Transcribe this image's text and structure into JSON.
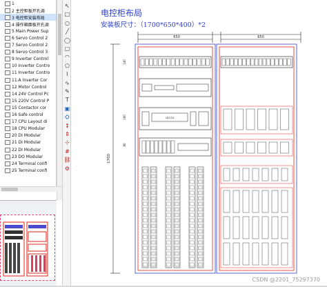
{
  "tree": {
    "items": [
      {
        "label": "1",
        "partial": true
      },
      {
        "label": "2 主控柜板开孔调"
      },
      {
        "label": "3 电控柜安装布局",
        "selected": true
      },
      {
        "label": "4 操作箱面板开孔调"
      },
      {
        "label": "5 Main Power Sup"
      },
      {
        "label": "6 Servo Control 2"
      },
      {
        "label": "7 Servo Control 2"
      },
      {
        "label": "8 Servo Control 3"
      },
      {
        "label": "9 Inverter Control"
      },
      {
        "label": "10 Inverter Contro"
      },
      {
        "label": "11 Inverter Contro"
      },
      {
        "label": "11.A Inverter Cor"
      },
      {
        "label": "12 Motor Control"
      },
      {
        "label": "14 24V Control Pc"
      },
      {
        "label": "15 220V Control P"
      },
      {
        "label": "15 Contactor cor"
      },
      {
        "label": "16 Safe control"
      },
      {
        "label": "17 CPU Layout di"
      },
      {
        "label": "18 CPU Modular"
      },
      {
        "label": "20 DI Modular"
      },
      {
        "label": "21 DI Modular"
      },
      {
        "label": "22 DI Modular"
      },
      {
        "label": "23 DO Modular"
      },
      {
        "label": "24 Terminal confi"
      },
      {
        "label": "25 Terminal confi"
      }
    ]
  },
  "toolbar": {
    "tools": [
      "pointer-tool-icon",
      "rectangle-tool-icon",
      "circle-tool-icon",
      "line-tool-icon",
      "ellipse-tool-icon",
      "rounded-rect-tool-icon",
      "arc-tool-icon",
      "polygon-tool-icon",
      "polyline-tool-icon",
      "spline-tool-icon",
      "freehand-tool-icon",
      "text-tool-icon",
      "image-tool-icon",
      "symbol-tool-icon",
      "dimension-tool-icon",
      "measure-tool-icon",
      "snap-tool-icon",
      "grid-tool-icon",
      "link-tool-icon",
      "settings-tool-icon"
    ]
  },
  "drawing": {
    "title": "电控柜布局",
    "subtitle": "安装板尺寸：（1700*650*400）*2",
    "dim_650_a": "650",
    "dim_650_b": "650",
    "dim_1700": "1700",
    "side_dim_140": "140",
    "side_dim_160": "160",
    "side_dim_80": "80",
    "lcd_label": "LD2/24",
    "colors": {
      "cabinet_red": "#e2231a",
      "cabinet_blue": "#3040d0",
      "ink": "#1c1c1c",
      "title_blue": "#2c3fc8"
    }
  },
  "watermark": "CSDN @2201_75297370"
}
